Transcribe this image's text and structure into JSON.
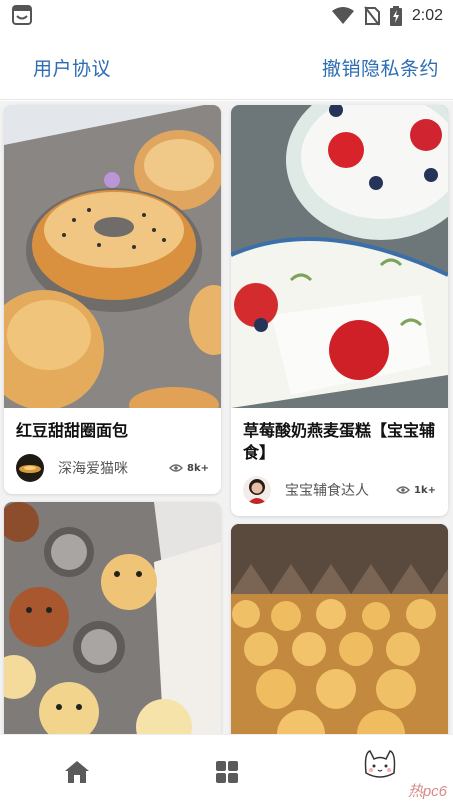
{
  "status_bar": {
    "time": "2:02",
    "icons": [
      "app-notification-icon",
      "wifi-icon",
      "no-sim-icon",
      "battery-charging-icon"
    ]
  },
  "top_bar": {
    "user_agreement": "用户协议",
    "revoke_privacy": "撤销隐私条约"
  },
  "colors": {
    "accent": "#2d6db3",
    "background": "#f2f2f2"
  },
  "feed": {
    "left": [
      {
        "title": "红豆甜甜圈面包",
        "author": "深海爱猫咪",
        "views": "8k+",
        "image": "donut-bread-photo",
        "avatar": "sunset-avatar"
      },
      {
        "title": "",
        "author": "",
        "views": "",
        "image": "animal-buns-photo",
        "avatar": ""
      }
    ],
    "right": [
      {
        "title": "草莓酸奶燕麦蛋糕【宝宝辅食】",
        "author": "宝宝辅食达人",
        "views": "1k+",
        "image": "strawberry-yogurt-cake-photo",
        "avatar": "woman-avatar"
      },
      {
        "title": "",
        "author": "",
        "views": "",
        "image": "cookies-baking-tray-photo",
        "avatar": ""
      }
    ]
  },
  "bottom_nav": {
    "items": [
      "home-icon",
      "grid-icon",
      "cat-profile-icon"
    ],
    "watermark": "热pc6"
  }
}
